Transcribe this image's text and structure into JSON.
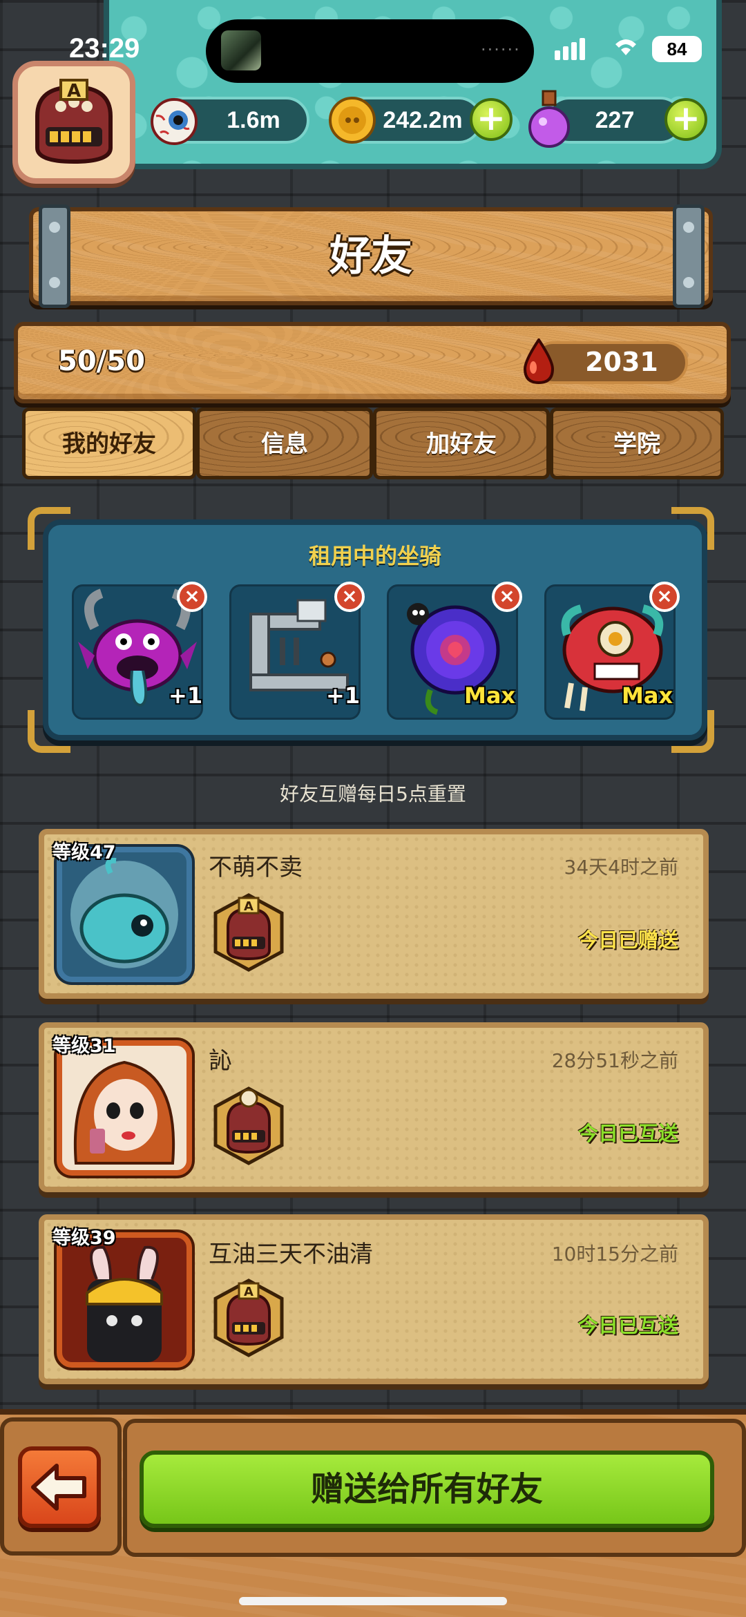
{
  "status_bar": {
    "time": "23:29",
    "battery": "84"
  },
  "resources": {
    "eyeball": "1.6m",
    "coins": "242.2m",
    "potion": "227",
    "plus": "+"
  },
  "header": {
    "title": "好友"
  },
  "friend_count": "50/50",
  "blood_points": "2031",
  "tabs": [
    {
      "label": "我的好友",
      "active": true
    },
    {
      "label": "信息",
      "active": false
    },
    {
      "label": "加好友",
      "active": false
    },
    {
      "label": "学院",
      "active": false
    }
  ],
  "mounts": {
    "title": "租用中的坐骑",
    "remove": "×",
    "items": [
      {
        "icon": "purple-horned-monster-mount",
        "level": "+1"
      },
      {
        "icon": "mechanical-pipe-mount",
        "level": "+1"
      },
      {
        "icon": "purple-rose-mount",
        "level": "Max"
      },
      {
        "icon": "lion-dance-mount",
        "level": "Max"
      }
    ]
  },
  "reset_note": "好友互赠每日5点重置",
  "friends": [
    {
      "level": "等级47",
      "name": "不萌不卖",
      "time": "34天4时之前",
      "status": "今日已赠送",
      "status_color": "#ffe44a",
      "avatar": "teal-bubble-creature"
    },
    {
      "level": "等级31",
      "name": "訫",
      "time": "28分51秒之前",
      "status": "今日已互送",
      "status_color": "#8ce02a",
      "avatar": "red-haired-girl"
    },
    {
      "level": "等级39",
      "name": "互油三天不油清",
      "time": "10时15分之前",
      "status": "今日已互送",
      "status_color": "#8ce02a",
      "avatar": "bunny-ear-helmet-creature"
    }
  ],
  "send_all_button": "赠送给所有好友",
  "colors": {
    "accent_green": "#8ce02a",
    "gift_yellow": "#ffe44a",
    "wood": "#dca15a"
  }
}
